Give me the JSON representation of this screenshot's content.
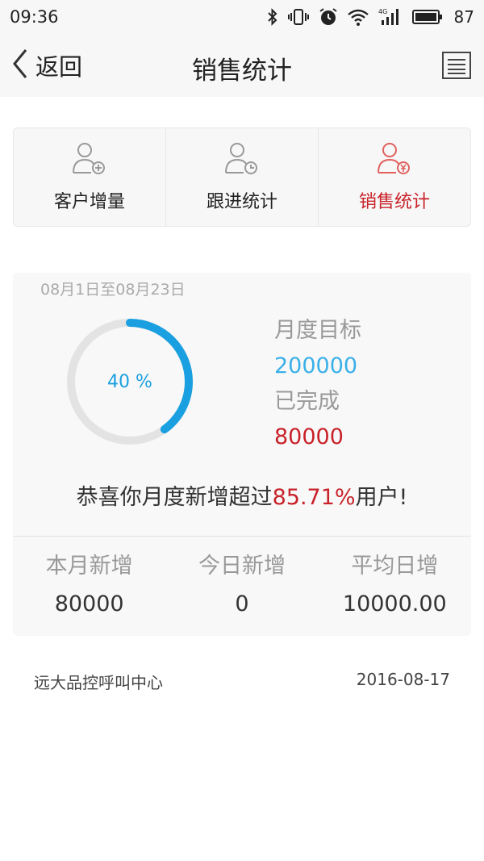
{
  "status_bar": {
    "time": "09:36",
    "icons": [
      "bluetooth-icon",
      "vibrate-icon",
      "alarm-icon",
      "wifi-icon",
      "signal-4g-icon",
      "battery-icon"
    ],
    "battery": "87"
  },
  "nav": {
    "back_label": "返回",
    "title": "销售统计",
    "menu_icon": "list-icon"
  },
  "tabs": [
    {
      "label": "客户增量",
      "icon": "user-add-icon",
      "active": false
    },
    {
      "label": "跟进统计",
      "icon": "user-clock-icon",
      "active": false
    },
    {
      "label": "销售统计",
      "icon": "user-yen-icon",
      "active": true
    }
  ],
  "stats": {
    "date_range": "08月1日至08月23日",
    "progress_text": "40 %",
    "progress": 0.4,
    "goal_label": "月度目标",
    "goal_value": "200000",
    "done_label": "已完成",
    "done_value": "80000",
    "congrats_prefix": "恭喜你月度新增超过",
    "congrats_pct": "85.71%",
    "congrats_suffix": "用户!",
    "metrics": [
      {
        "label": "本月新增",
        "value": "80000"
      },
      {
        "label": "今日新增",
        "value": "0"
      },
      {
        "label": "平均日增",
        "value": "10000.00"
      }
    ]
  },
  "footer": {
    "org": "远大品控呼叫中心",
    "date": "2016-08-17"
  },
  "colors": {
    "accent_blue": "#1a9fe0",
    "accent_red": "#c8222a",
    "ring_track": "#e3e3e3"
  }
}
